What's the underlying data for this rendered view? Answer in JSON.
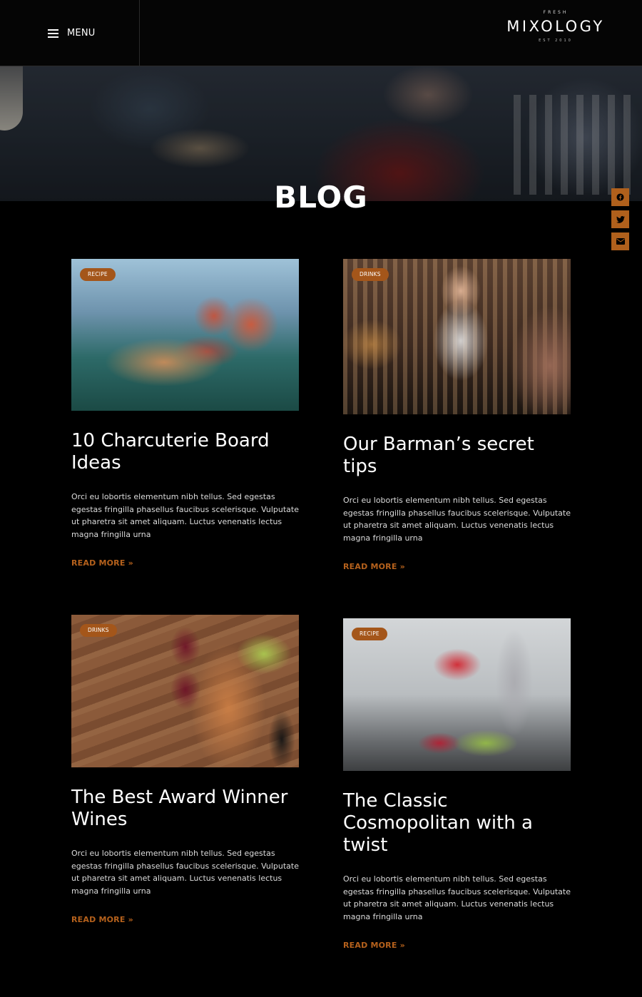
{
  "header": {
    "menu_label": "MENU",
    "logo": {
      "top": "FRESH",
      "name": "MIXOLOGY",
      "est": "EST 2010"
    }
  },
  "page": {
    "title": "BLOG"
  },
  "social": [
    {
      "name": "facebook-icon"
    },
    {
      "name": "twitter-icon"
    },
    {
      "name": "envelope-icon"
    }
  ],
  "posts": [
    {
      "category": "RECIPE",
      "title": "10 Charcuterie Board Ideas",
      "excerpt": "Orci eu lobortis elementum nibh tellus. Sed egestas egestas fringilla phasellus faucibus scelerisque. Vulputate ut pharetra sit amet aliquam. Luctus venenatis lectus magna fringilla urna",
      "read_more": "READ MORE »"
    },
    {
      "category": "DRINKS",
      "title": "Our Barman’s secret tips",
      "excerpt": "Orci eu lobortis elementum nibh tellus. Sed egestas egestas fringilla phasellus faucibus scelerisque. Vulputate ut pharetra sit amet aliquam. Luctus venenatis lectus magna fringilla urna",
      "read_more": "READ MORE »"
    },
    {
      "category": "DRINKS",
      "title": "The Best Award Winner Wines",
      "excerpt": "Orci eu lobortis elementum nibh tellus. Sed egestas egestas fringilla phasellus faucibus scelerisque. Vulputate ut pharetra sit amet aliquam. Luctus venenatis lectus magna fringilla urna",
      "read_more": "READ MORE »"
    },
    {
      "category": "RECIPE",
      "title": "The Classic Cosmopolitan with a twist",
      "excerpt": "Orci eu lobortis elementum nibh tellus. Sed egestas egestas fringilla phasellus faucibus scelerisque. Vulputate ut pharetra sit amet aliquam. Luctus venenatis lectus magna fringilla urna",
      "read_more": "READ MORE »"
    }
  ],
  "colors": {
    "accent": "#b0601c",
    "background": "#000000",
    "badge": "#a4561a"
  }
}
